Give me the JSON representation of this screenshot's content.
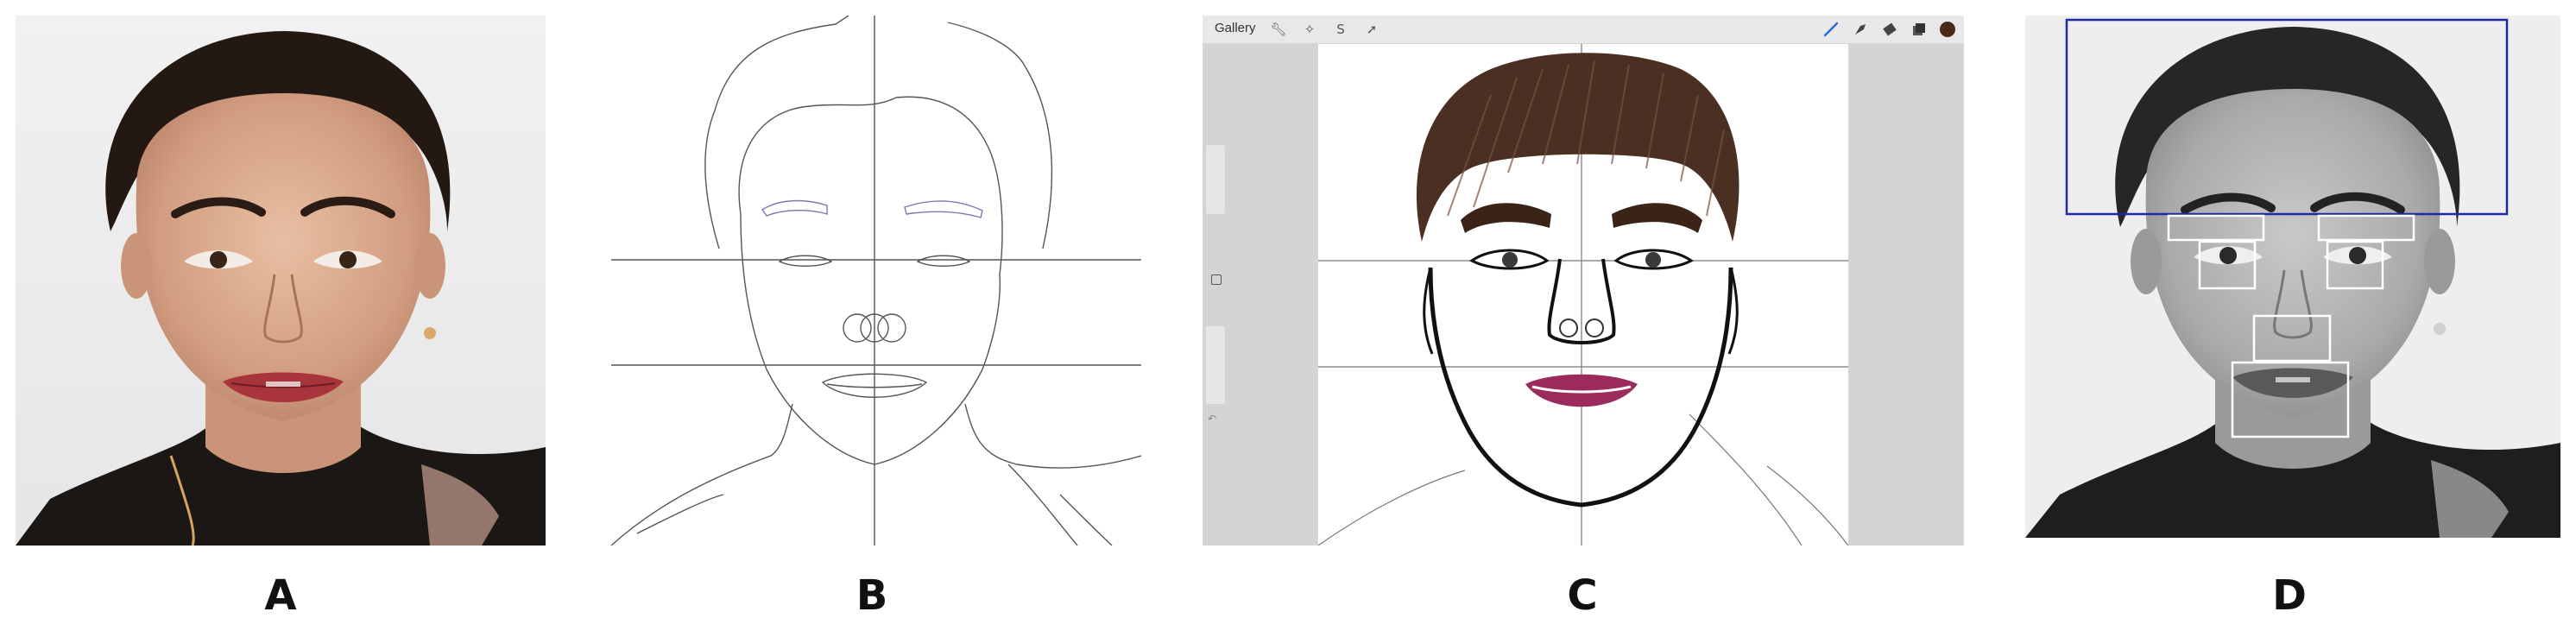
{
  "figure": {
    "panels": [
      {
        "id": "A",
        "label": "A",
        "kind": "color photograph of woman's face"
      },
      {
        "id": "B",
        "label": "B",
        "kind": "line sketch with facial guide lines"
      },
      {
        "id": "C",
        "label": "C",
        "kind": "digital drawing in sketching app"
      },
      {
        "id": "D",
        "label": "D",
        "kind": "grayscale photograph with feature boxes"
      }
    ]
  },
  "app": {
    "gallery_label": "Gallery",
    "tools": [
      "wrench-icon",
      "magic-wand-icon",
      "selection-icon",
      "transform-arrow-icon",
      "brush-icon",
      "smudge-icon",
      "eraser-icon",
      "layers-icon",
      "color-swatch-icon"
    ],
    "accent_color": "#2b6cd8",
    "swatch_color": "#4a2a1a"
  },
  "colors": {
    "skin": "#d9a98a",
    "hair": "#2a1c14",
    "lips_photo": "#a8343c",
    "lips_drawing": "#9b2b5a",
    "hair_drawing": "#4a2f22",
    "box_blue": "#1f2a9e",
    "box_white": "#ffffff"
  }
}
